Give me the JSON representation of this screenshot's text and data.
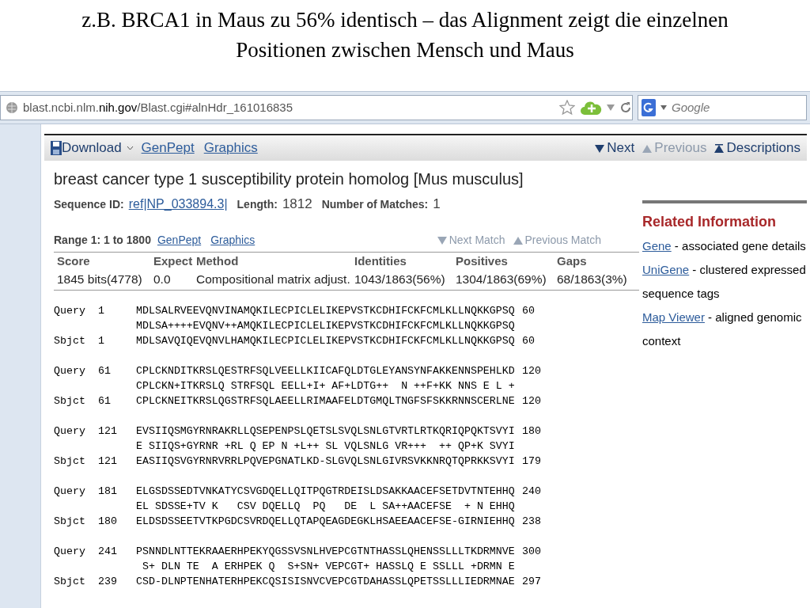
{
  "slide_title": "z.B. BRCA1 in Maus zu 56% identisch – das Alignment zeigt die einzelnen Positionen zwischen Mensch und Maus",
  "browser": {
    "url_host_prefix": "blast.ncbi.nlm.",
    "url_host_bold": "nih.gov",
    "url_path": "/Blast.cgi#alnHdr_161016835",
    "search_placeholder": "Google"
  },
  "toolbar": {
    "download": "Download",
    "links": [
      "GenPept",
      "Graphics"
    ],
    "nav": [
      {
        "label": "Next",
        "disabled": false,
        "kind": "down"
      },
      {
        "label": "Previous",
        "disabled": true,
        "kind": "up"
      },
      {
        "label": "Descriptions",
        "disabled": false,
        "kind": "top"
      }
    ]
  },
  "hit": {
    "title": "breast cancer type 1 susceptibility protein homolog [Mus musculus]",
    "seq_id_label": "Sequence ID:",
    "seq_id": "ref|NP_033894.3|",
    "length_label": "Length:",
    "length": "1812",
    "matches_label": "Number of Matches:",
    "matches": "1"
  },
  "range": {
    "label": "Range 1: 1 to 1800",
    "links": [
      "GenPept",
      "Graphics"
    ],
    "nav": [
      {
        "label": "Next Match",
        "disabled": true,
        "kind": "down"
      },
      {
        "label": "Previous Match",
        "disabled": true,
        "kind": "up"
      }
    ]
  },
  "table": {
    "columns": [
      "Score",
      "Expect",
      "Method",
      "Identities",
      "Positives",
      "Gaps"
    ],
    "rows": [
      [
        "1845 bits(4778)",
        "0.0",
        "Compositional matrix adjust.",
        "1043/1863(56%)",
        "1304/1863(69%)",
        "68/1863(3%)"
      ]
    ]
  },
  "related": {
    "title": "Related Information",
    "items": [
      {
        "link": "Gene",
        "text": "- associated gene details"
      },
      {
        "link": "UniGene",
        "text": "- clustered expressed sequence tags"
      },
      {
        "link": "Map Viewer",
        "text": "- aligned genomic context"
      }
    ]
  },
  "alignment": [
    {
      "query": [
        "Query",
        "1",
        "MDLSALRVEEVQNVINAMQKILECPICLELIKEPVSTKCDHIFCKFCMLKLLNQKKGPSQ",
        "60"
      ],
      "match": "MDLSA++++EVQNV++AMQKILECPICLELIKEPVSTKCDHIFCKFCMLKLLNQKKGPSQ",
      "sbjct": [
        "Sbjct",
        "1",
        "MDLSAVQIQEVQNVLHAMQKILECPICLELIKEPVSTKCDHIFCKFCMLKLLNQKKGPSQ",
        "60"
      ]
    },
    {
      "query": [
        "Query",
        "61",
        "CPLCKNDITKRSLQESTRFSQLVEELLKIICAFQLDTGLEYANSYNFAKKENNSPEHLKD",
        "120"
      ],
      "match": "CPLCKN+ITKRSLQ STRFSQL EELL+I+ AF+LDTG++  N ++F+KK NNS E L +",
      "sbjct": [
        "Sbjct",
        "61",
        "CPLCKNEITKRSLQGSTRFSQLAEELLRIMAAFELDTGMQLTNGFSFSKKRNNSCERLNE",
        "120"
      ]
    },
    {
      "query": [
        "Query",
        "121",
        "EVSIIQSMGYRNRAKRLLQSEPENPSLQETSLSVQLSNLGTVRTLRTKQRIQPQKTSVYI",
        "180"
      ],
      "match": "E SIIQS+GYRNR +RL Q EP N +L++ SL VQLSNLG VR+++  ++ QP+K SVYI",
      "sbjct": [
        "Sbjct",
        "121",
        "EASIIQSVGYRNRVRRLPQVEPGNATLKD-SLGVQLSNLGIVRSVKKNRQTQPRKKSVYI",
        "179"
      ]
    },
    {
      "query": [
        "Query",
        "181",
        "ELGSDSSEDTVNKATYCSVGDQELLQITPQGTRDEISLDSAKKAACEFSETDVTNTEHHQ",
        "240"
      ],
      "match": "EL SDSSE+TV K   CSV DQELLQ  PQ   DE  L SA++AACEFSE  + N EHHQ",
      "sbjct": [
        "Sbjct",
        "180",
        "ELDSDSSEETVTKPGDCSVRDQELLQTAPQEAGDEGKLHSAEEAACEFSE-GIRNIEHHQ",
        "238"
      ]
    },
    {
      "query": [
        "Query",
        "241",
        "PSNNDLNTTEKRAAERHPEKYQGSSVSNLHVEPCGTNTHASSLQHENSSLLLTKDRMNVE",
        "300"
      ],
      "match": " S+ DLN TE  A ERHPEK Q  S+SN+ VEPCGT+ HASSLQ E SSLLL +DRMN E",
      "sbjct": [
        "Sbjct",
        "239",
        "CSD-DLNPTENHATERHPEKCQSISISNVCVEPCGTDAHASSLQPETSSLLLIEDRMNAE",
        "297"
      ]
    }
  ]
}
